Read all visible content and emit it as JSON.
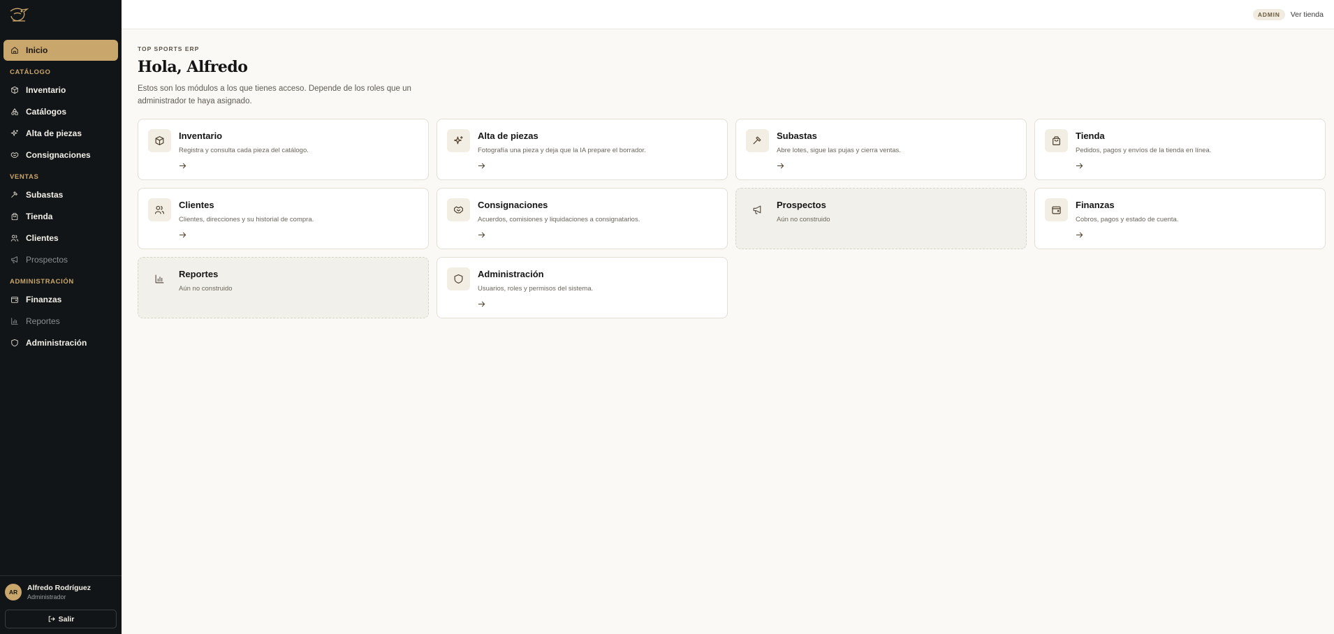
{
  "sidebar": {
    "logo_icon": "pelican-logo-icon",
    "home": "Inicio",
    "sections": [
      {
        "title": "CATÁLOGO",
        "items": [
          {
            "label": "Inventario",
            "icon": "box-icon",
            "muted": false
          },
          {
            "label": "Catálogos",
            "icon": "shapes-icon",
            "muted": false
          },
          {
            "label": "Alta de piezas",
            "icon": "sparkles-icon",
            "muted": false
          },
          {
            "label": "Consignaciones",
            "icon": "handshake-icon",
            "muted": false
          }
        ]
      },
      {
        "title": "VENTAS",
        "items": [
          {
            "label": "Subastas",
            "icon": "gavel-icon",
            "muted": false
          },
          {
            "label": "Tienda",
            "icon": "bag-icon",
            "muted": false
          },
          {
            "label": "Clientes",
            "icon": "users-icon",
            "muted": false
          },
          {
            "label": "Prospectos",
            "icon": "megaphone-icon",
            "muted": true
          }
        ]
      },
      {
        "title": "ADMINISTRACIÓN",
        "items": [
          {
            "label": "Finanzas",
            "icon": "wallet-icon",
            "muted": false
          },
          {
            "label": "Reportes",
            "icon": "chart-icon",
            "muted": true
          },
          {
            "label": "Administración",
            "icon": "shield-icon",
            "muted": false
          }
        ]
      }
    ],
    "user": {
      "initials": "AR",
      "name": "Alfredo Rodríguez",
      "role": "Administrador"
    },
    "logout": "Salir"
  },
  "topbar": {
    "badge": "ADMIN",
    "store_link": "Ver tienda"
  },
  "main": {
    "eyebrow": "TOP SPORTS ERP",
    "title": "Hola, Alfredo",
    "subtitle": "Estos son los módulos a los que tienes acceso. Depende de los roles que un administrador te haya asignado."
  },
  "modules": [
    {
      "title": "Inventario",
      "desc": "Registra y consulta cada pieza del catálogo.",
      "icon": "box-icon",
      "disabled": false
    },
    {
      "title": "Alta de piezas",
      "desc": "Fotografía una pieza y deja que la IA prepare el borrador.",
      "icon": "sparkles-icon",
      "disabled": false
    },
    {
      "title": "Subastas",
      "desc": "Abre lotes, sigue las pujas y cierra ventas.",
      "icon": "gavel-icon",
      "disabled": false
    },
    {
      "title": "Tienda",
      "desc": "Pedidos, pagos y envíos de la tienda en línea.",
      "icon": "bag-icon",
      "disabled": false
    },
    {
      "title": "Clientes",
      "desc": "Clientes, direcciones y su historial de compra.",
      "icon": "users-icon",
      "disabled": false
    },
    {
      "title": "Consignaciones",
      "desc": "Acuerdos, comisiones y liquidaciones a consignatarios.",
      "icon": "handshake-icon",
      "disabled": false
    },
    {
      "title": "Prospectos",
      "desc": "Aún no construido",
      "icon": "megaphone-icon",
      "disabled": true
    },
    {
      "title": "Finanzas",
      "desc": "Cobros, pagos y estado de cuenta.",
      "icon": "wallet-icon",
      "disabled": false
    },
    {
      "title": "Reportes",
      "desc": "Aún no construido",
      "icon": "chart-icon",
      "disabled": true
    },
    {
      "title": "Administración",
      "desc": "Usuarios, roles y permisos del sistema.",
      "icon": "shield-icon",
      "disabled": false
    }
  ],
  "colors": {
    "accent": "#c9a66b",
    "sidebar_bg": "#121517",
    "page_bg": "#faf9f6"
  }
}
